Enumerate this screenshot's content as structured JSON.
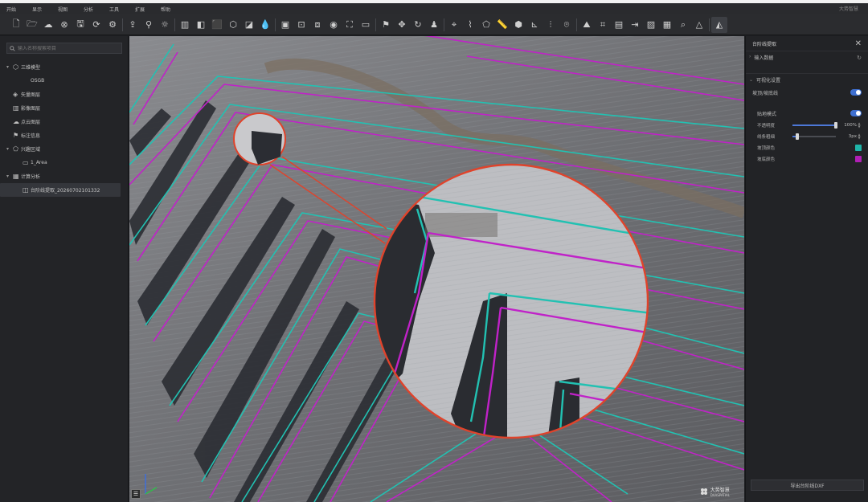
{
  "menu": [
    "开始",
    "显示",
    "视图",
    "分析",
    "工具",
    "扩展",
    "帮助"
  ],
  "menu_right": "大势智慧",
  "toolbar_icons": [
    "new-file-icon",
    "open-folder-icon",
    "cloud-icon",
    "close-circle-icon",
    "save-icon",
    "refresh-icon",
    "settings-icon",
    "upload-model-icon",
    "person-icon",
    "sun-icon",
    "panel-icon",
    "layers-icon",
    "cube-icon",
    "cube-edit-icon",
    "gradient-icon",
    "droplet-icon",
    "box-icon",
    "box-check-icon",
    "frame-icon",
    "eye-icon",
    "fit-view-icon",
    "screen-icon",
    "flag-icon",
    "move-icon",
    "rotate-eye-icon",
    "person-view-icon",
    "location-pin-icon",
    "contour-icon",
    "polygon-icon",
    "ruler-icon",
    "volume-icon",
    "chart-icon",
    "split-icon",
    "camera-icon",
    "terrain-icon",
    "crop-icon",
    "document-icon",
    "export-icon",
    "image-icon",
    "report-icon",
    "search-icon",
    "mountain-icon",
    "contour-active-icon"
  ],
  "left": {
    "search_placeholder": "输入名称搜索项目",
    "tree": [
      {
        "level": 0,
        "caret": "▾",
        "icon": "⬡",
        "icon_name": "cube-outline-icon",
        "label": "三维模型",
        "selected": false
      },
      {
        "level": 1,
        "caret": "",
        "icon": "",
        "icon_name": "",
        "label": "OSGB",
        "selected": false
      },
      {
        "level": 0,
        "caret": "",
        "icon": "◈",
        "icon_name": "vector-layer-icon",
        "label": "矢量图层",
        "selected": false
      },
      {
        "level": 0,
        "caret": "",
        "icon": "▥",
        "icon_name": "image-layer-icon",
        "label": "影像图层",
        "selected": false
      },
      {
        "level": 0,
        "caret": "",
        "icon": "☁",
        "icon_name": "point-cloud-icon",
        "label": "点云图层",
        "selected": false
      },
      {
        "level": 0,
        "caret": "",
        "icon": "⚑",
        "icon_name": "annotation-icon",
        "label": "标注信息",
        "selected": false
      },
      {
        "level": 0,
        "caret": "▾",
        "icon": "⬠",
        "icon_name": "region-icon",
        "label": "兴趣区域",
        "selected": false
      },
      {
        "level": 1,
        "caret": "",
        "icon": "▭",
        "icon_name": "area-icon",
        "label": "1_Area",
        "selected": false
      },
      {
        "level": 0,
        "caret": "▾",
        "icon": "▦",
        "icon_name": "calculation-icon",
        "label": "计算分析",
        "selected": false
      },
      {
        "level": 1,
        "caret": "",
        "icon": "◫",
        "icon_name": "contour-result-icon",
        "label": "台阶线提取_20260702101332",
        "selected": true
      }
    ]
  },
  "right": {
    "title": "台阶线提取",
    "input_section": "输入数据",
    "vis_section": "可视化设置",
    "toggle_main": "坡顶/坡底线",
    "toggle_sub": "贴地模式",
    "opacity_label": "不透明度",
    "opacity_value": "100%",
    "opacity_fraction": 1.0,
    "width_label": "线条粗细",
    "width_value": "3px",
    "width_fraction": 0.12,
    "top_color_label": "坡顶颜色",
    "top_color": "#1fb5a9",
    "bottom_color_label": "坡底颜色",
    "bottom_color": "#b01fb5",
    "export_label": "导出台阶线DXF"
  },
  "viewport": {
    "watermark": "大势智慧",
    "watermark_sub": "DAASPATIAL",
    "corner_button": "☰"
  }
}
